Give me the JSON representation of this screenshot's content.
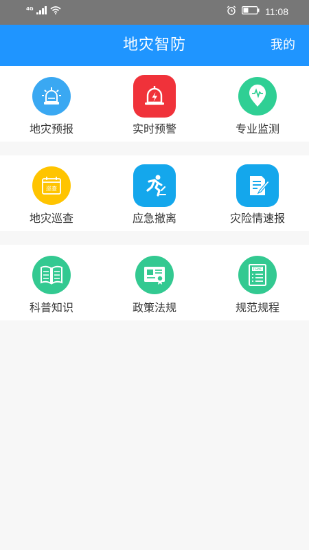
{
  "status_bar": {
    "network": "4G",
    "time": "11:08",
    "icons": [
      "signal-icon",
      "wifi-icon",
      "alarm-icon",
      "battery-icon"
    ]
  },
  "header": {
    "title": "地灾智防",
    "mine_label": "我的",
    "color": "#1f95ff"
  },
  "sections": [
    {
      "items": [
        {
          "label": "地灾预报",
          "icon": "alarm-light-icon",
          "color": "#3aa8f2"
        },
        {
          "label": "实时预警",
          "icon": "warning-bell-icon",
          "color": "#f0323a"
        },
        {
          "label": "专业监测",
          "icon": "monitor-pin-icon",
          "color": "#2fcf94"
        }
      ]
    },
    {
      "items": [
        {
          "label": "地灾巡查",
          "icon": "patrol-calendar-icon",
          "color": "#ffc400",
          "badge": "巡查"
        },
        {
          "label": "应急撤离",
          "icon": "running-person-icon",
          "color": "#14a7ec"
        },
        {
          "label": "灾险情速报",
          "icon": "report-edit-icon",
          "color": "#14a7ec"
        }
      ]
    },
    {
      "items": [
        {
          "label": "科普知识",
          "icon": "open-book-icon",
          "color": "#33c991"
        },
        {
          "label": "政策法规",
          "icon": "certificate-icon",
          "color": "#33c991"
        },
        {
          "label": "规范规程",
          "icon": "checklist-book-icon",
          "color": "#33c991",
          "badge": "TGBC"
        }
      ]
    }
  ]
}
